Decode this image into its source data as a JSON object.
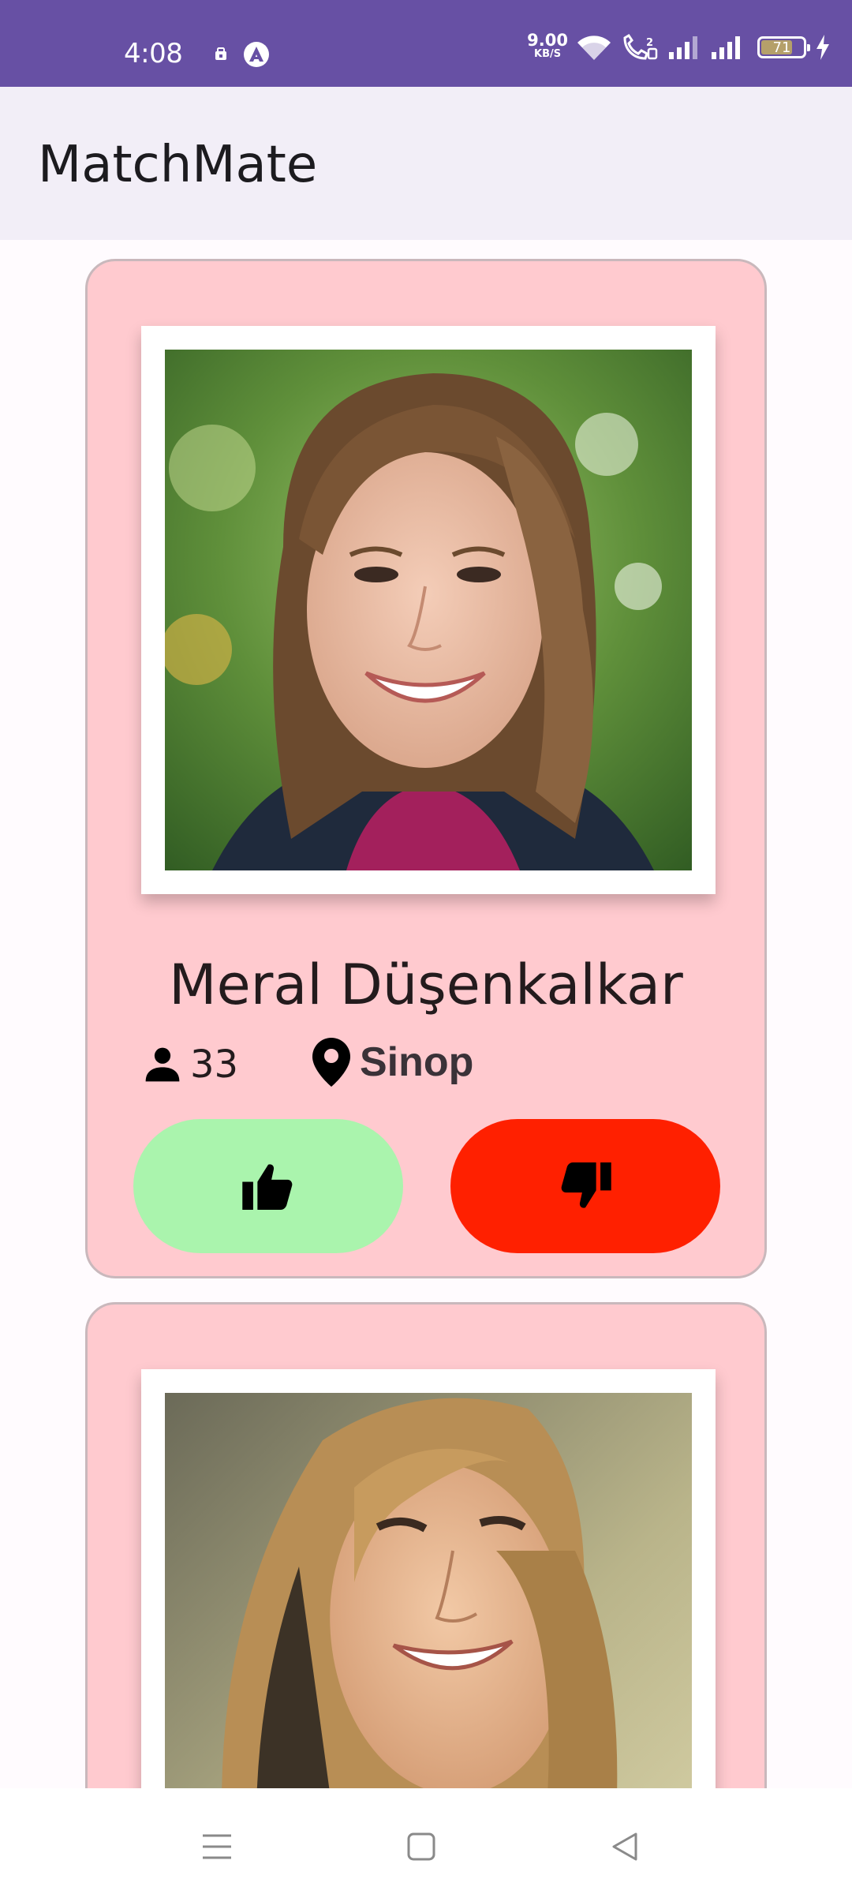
{
  "status_bar": {
    "time": "4:08",
    "speed_value": "9.00",
    "speed_unit": "KB/S",
    "battery": "71",
    "icons": [
      "notification-icon",
      "app-icon",
      "wifi-icon",
      "volte-icon",
      "signal-icon",
      "signal-icon",
      "battery-icon",
      "charging-icon"
    ]
  },
  "app_bar": {
    "title": "MatchMate"
  },
  "cards": [
    {
      "name": "Meral Düşenkalkar",
      "age": "33",
      "city": "Sinop",
      "like_icon": "thumbs-up-icon",
      "dislike_icon": "thumbs-down-icon"
    },
    {
      "name": "",
      "age": "",
      "city": ""
    }
  ],
  "colors": {
    "status_bar": "#6750A4",
    "app_bar": "#F2EEF7",
    "card_bg": "#FFCACF",
    "like_button": "#AAF4AD",
    "dislike_button": "#FF2000"
  },
  "nav_bar": {
    "icons": [
      "menu-icon",
      "home-icon",
      "back-icon"
    ]
  }
}
